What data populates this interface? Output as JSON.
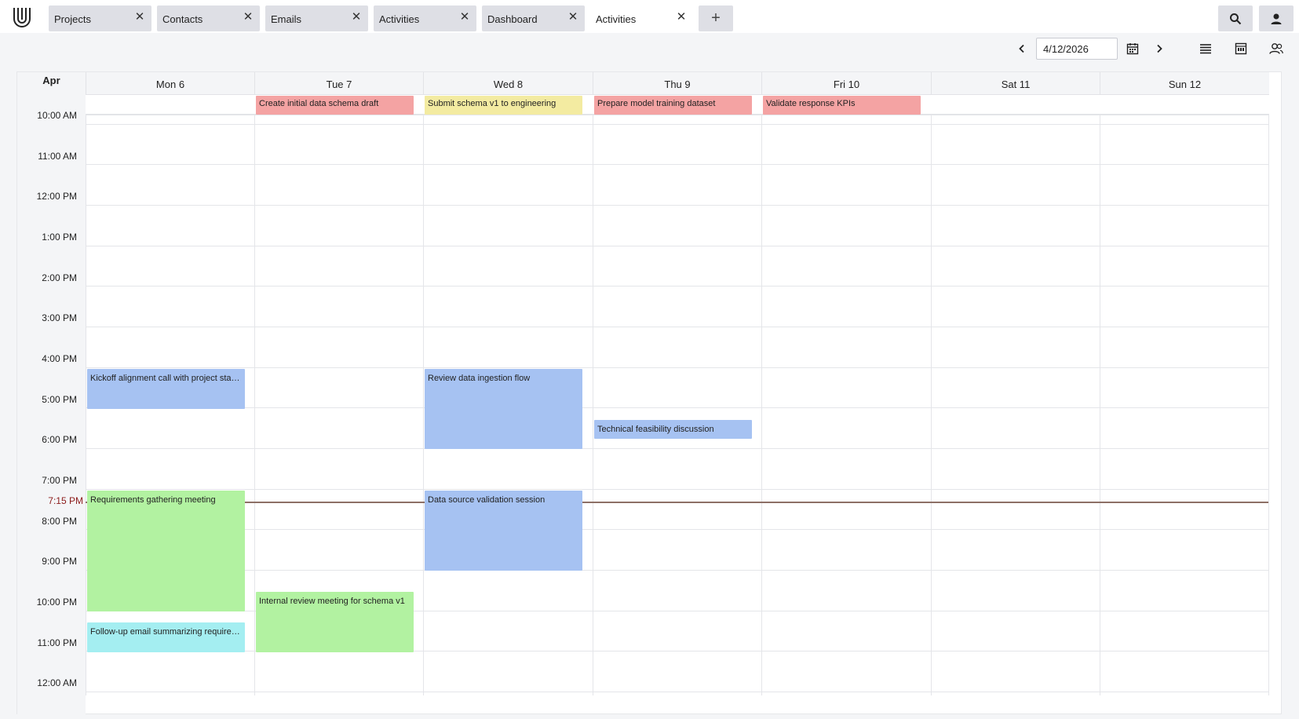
{
  "tabs": [
    {
      "label": "Projects",
      "active": false
    },
    {
      "label": "Contacts",
      "active": false
    },
    {
      "label": "Emails",
      "active": false
    },
    {
      "label": "Activities",
      "active": false
    },
    {
      "label": "Dashboard",
      "active": false
    },
    {
      "label": "Activities",
      "active": true
    }
  ],
  "toolbar": {
    "date_value": "4/12/2026"
  },
  "calendar": {
    "month": "Apr",
    "days": [
      "Mon 6",
      "Tue 7",
      "Wed 8",
      "Thu 9",
      "Fri 10",
      "Sat 11",
      "Sun 12"
    ],
    "hours": [
      "10:00 AM",
      "11:00 AM",
      "12:00 PM",
      "1:00 PM",
      "2:00 PM",
      "3:00 PM",
      "4:00 PM",
      "5:00 PM",
      "6:00 PM",
      "7:00 PM",
      "8:00 PM",
      "9:00 PM",
      "10:00 PM",
      "11:00 PM",
      "12:00 AM"
    ],
    "now_label": "7:15 PM",
    "allday_events": [
      {
        "title": "Create initial data schema draft",
        "day": 1,
        "color": "#f4a3a3"
      },
      {
        "title": "Submit schema v1 to engineering",
        "day": 2,
        "color": "#f3eba1"
      },
      {
        "title": "Prepare model training dataset",
        "day": 3,
        "color": "#f4a3a3"
      },
      {
        "title": "Validate response KPIs",
        "day": 4,
        "color": "#f4a3a3"
      }
    ],
    "events": [
      {
        "title": "Kickoff alignment call with project stake…",
        "day": 0,
        "start": "4:00 PM",
        "end": "5:00 PM",
        "color": "#a6c2f2"
      },
      {
        "title": "Review data ingestion flow",
        "day": 2,
        "start": "4:00 PM",
        "end": "6:00 PM",
        "color": "#a6c2f2"
      },
      {
        "title": "Technical feasibility discussion",
        "day": 3,
        "start": "5:15 PM",
        "end": "5:45 PM",
        "color": "#a6c2f2"
      },
      {
        "title": "Requirements gathering meeting",
        "day": 0,
        "start": "7:00 PM",
        "end": "10:00 PM",
        "color": "#b2f2a1"
      },
      {
        "title": "Data source validation session",
        "day": 2,
        "start": "7:00 PM",
        "end": "9:00 PM",
        "color": "#a6c2f2"
      },
      {
        "title": "Internal review meeting for schema v1",
        "day": 1,
        "start": "9:30 PM",
        "end": "11:00 PM",
        "color": "#b2f2a1"
      },
      {
        "title": "Follow-up email summarizing requirem…",
        "day": 0,
        "start": "10:15 PM",
        "end": "11:00 PM",
        "color": "#a4eef1"
      }
    ]
  },
  "icons": {
    "logo": "u-logo-icon",
    "search": "search-icon",
    "account": "person-icon",
    "prev": "chevron-left-icon",
    "next": "chevron-right-icon",
    "calendar": "calendar-icon",
    "list_view": "list-view-icon",
    "week_view": "calendar-view-icon",
    "users": "users-icon"
  }
}
